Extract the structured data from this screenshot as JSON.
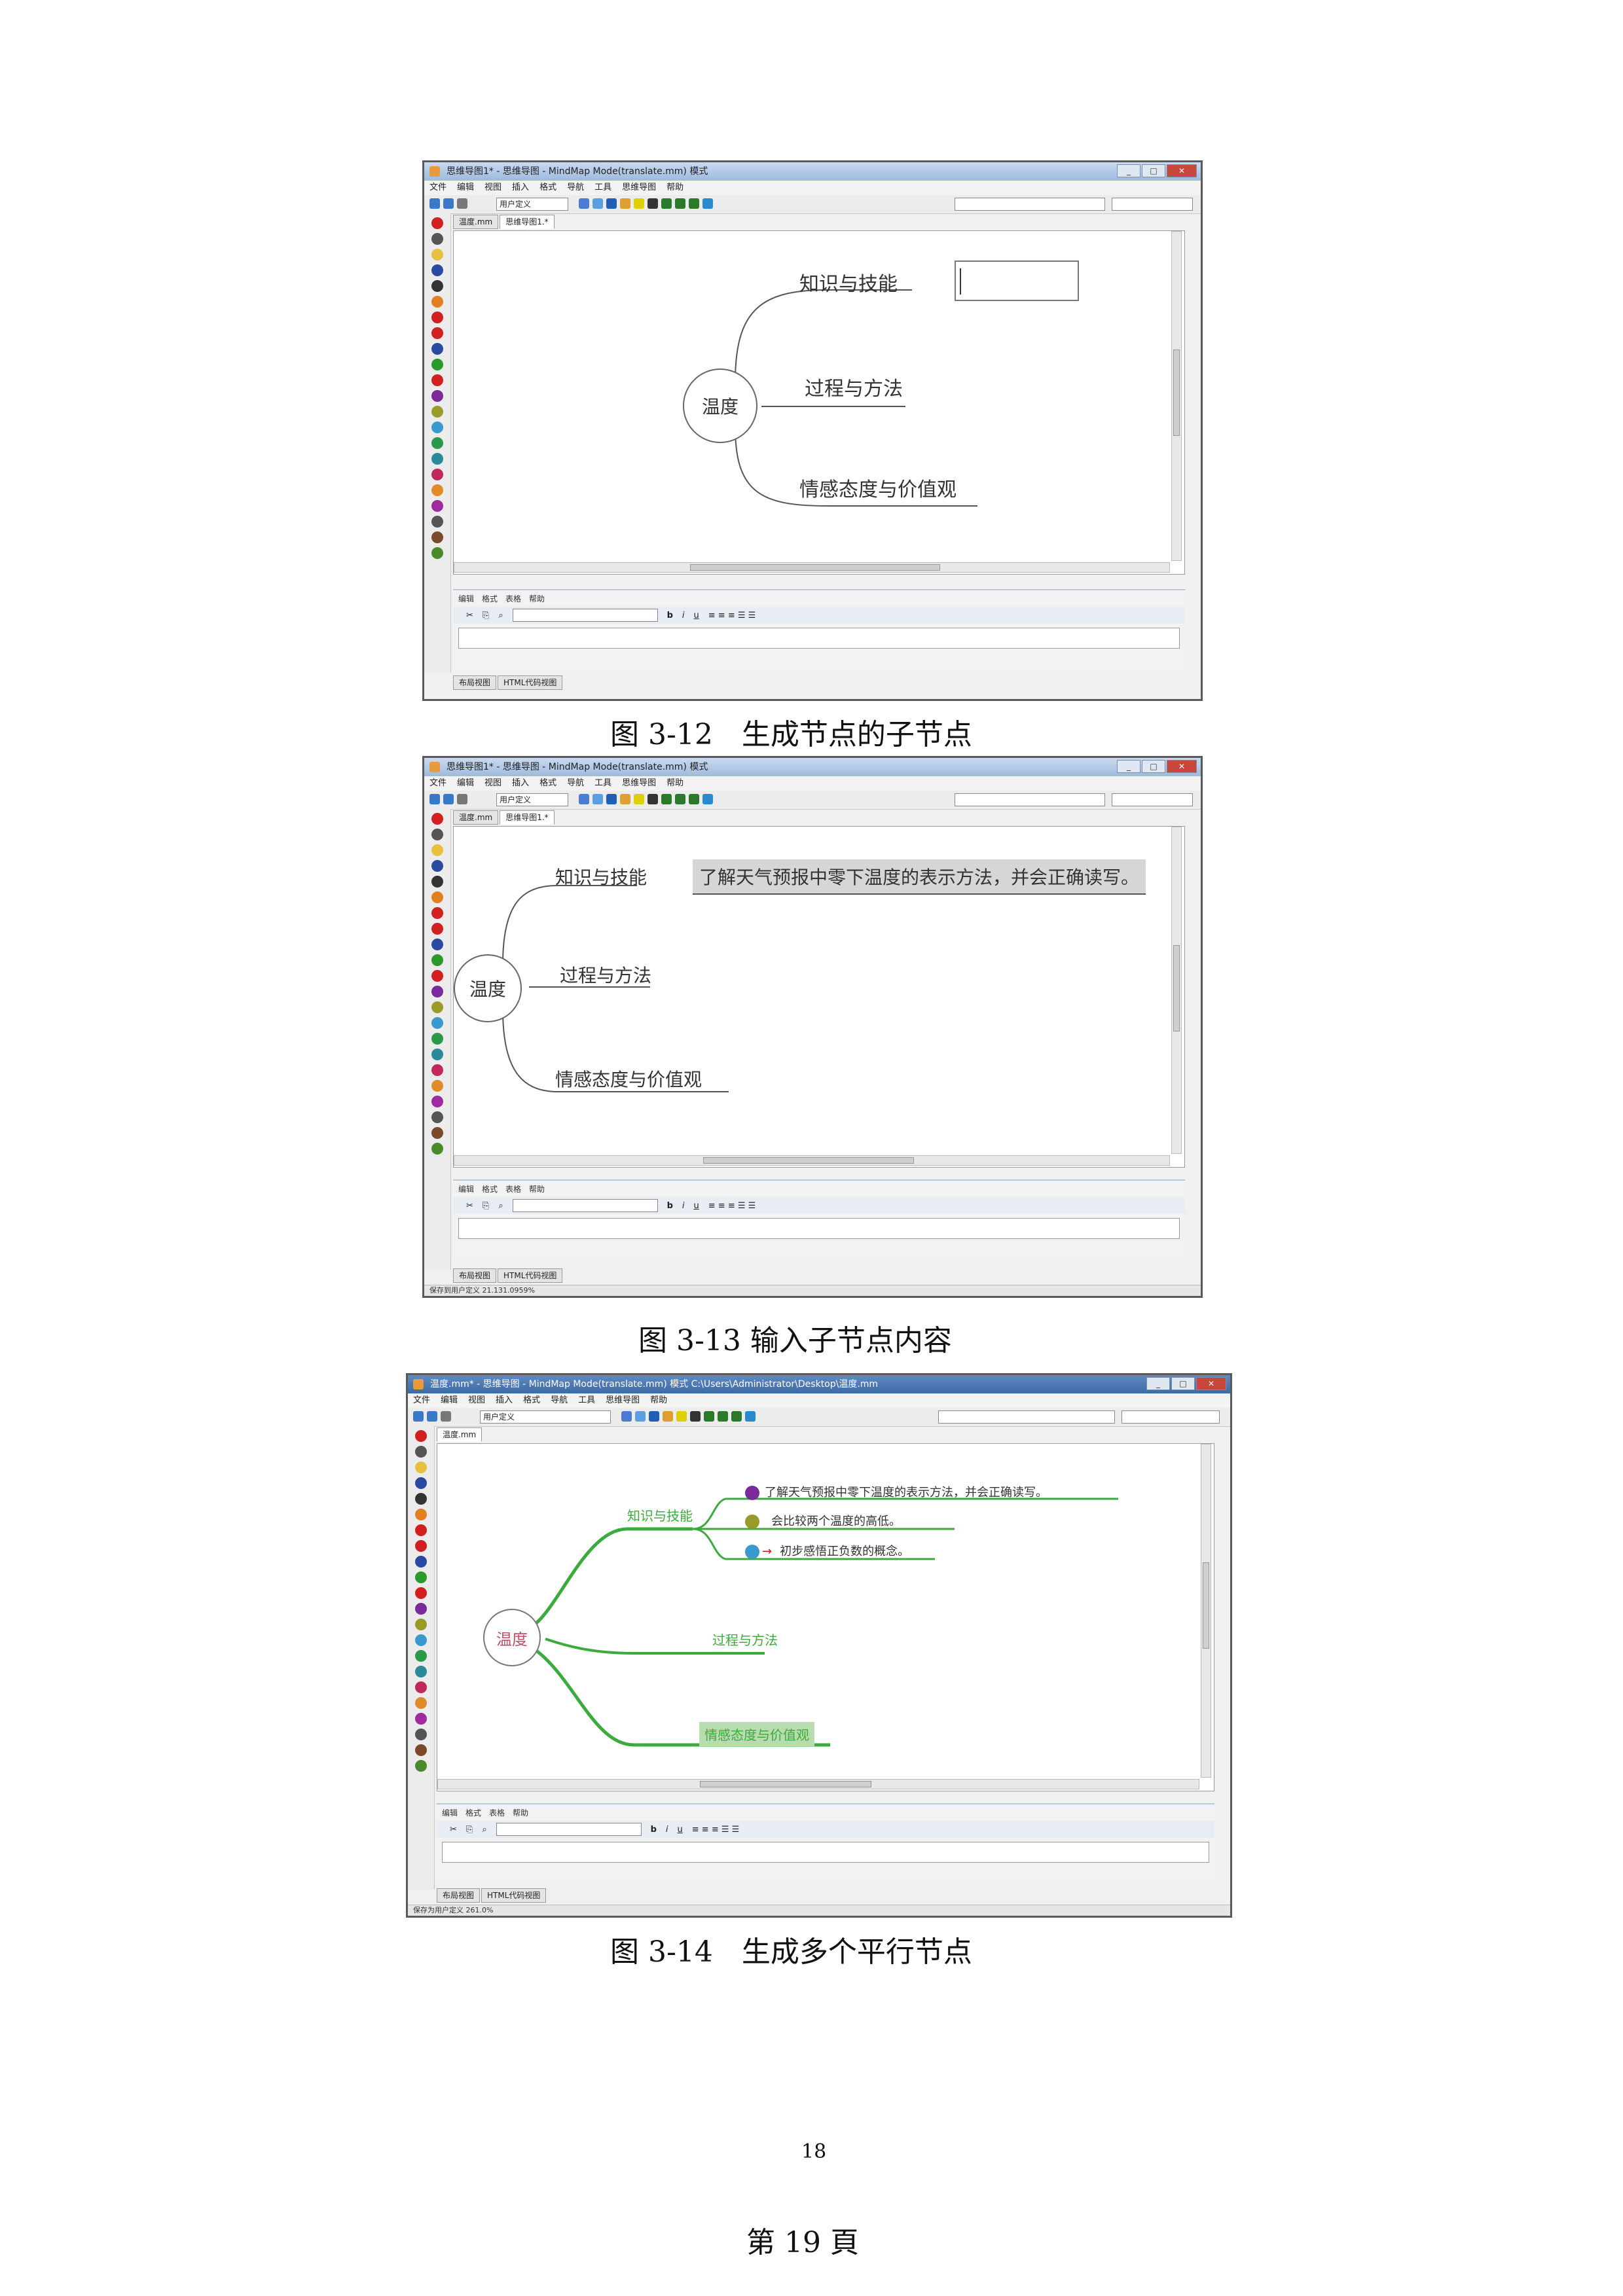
{
  "figures": [
    {
      "window_title": "思维导图1* - 思维导图 - MindMap Mode(translate.mm) 模式",
      "menu": [
        "文件",
        "编辑",
        "视图",
        "插入",
        "格式",
        "导航",
        "工具",
        "思维导图",
        "帮助"
      ],
      "style_value": "用户定义",
      "tabs": [
        "温度.mm",
        "思维导图1.*"
      ],
      "mindmap": {
        "root": "温度",
        "children": [
          "知识与技能",
          "过程与方法",
          "情感态度与价值观"
        ]
      },
      "notes_menu": [
        "编辑",
        "格式",
        "表格",
        "帮助"
      ],
      "bottom_tabs": [
        "布局视图",
        "HTML代码视图"
      ],
      "status": "",
      "caption": "图 3-12　生成节点的子节点"
    },
    {
      "window_title": "思维导图1* - 思维导图 - MindMap Mode(translate.mm) 模式",
      "menu": [
        "文件",
        "编辑",
        "视图",
        "插入",
        "格式",
        "导航",
        "工具",
        "思维导图",
        "帮助"
      ],
      "style_value": "用户定义",
      "tabs": [
        "温度.mm",
        "思维导图1.*"
      ],
      "mindmap": {
        "root": "温度",
        "children": [
          "知识与技能",
          "过程与方法",
          "情感态度与价值观"
        ],
        "edited_child": "了解天气预报中零下温度的表示方法，并会正确读写。"
      },
      "notes_menu": [
        "编辑",
        "格式",
        "表格",
        "帮助"
      ],
      "bottom_tabs": [
        "布局视图",
        "HTML代码视图"
      ],
      "status": "保存到用户定义 21.131.0959%",
      "caption": "图 3-13 输入子节点内容"
    },
    {
      "window_title": "温度.mm* - 思维导图 - MindMap Mode(translate.mm) 模式 C:\\Users\\Administrator\\Desktop\\温度.mm",
      "menu": [
        "文件",
        "编辑",
        "视图",
        "插入",
        "格式",
        "导航",
        "工具",
        "思维导图",
        "帮助"
      ],
      "style_value": "用户定义",
      "tabs": [
        "温度.mm"
      ],
      "mindmap": {
        "root": "温度",
        "children": [
          "知识与技能",
          "过程与方法",
          "情感态度与价值观"
        ],
        "grandchildren": [
          "了解天气预报中零下温度的表示方法，并会正确读写。",
          "会比较两个温度的高低。",
          "初步感悟正负数的概念。"
        ]
      },
      "notes_menu": [
        "编辑",
        "格式",
        "表格",
        "帮助"
      ],
      "bottom_tabs": [
        "布局视图",
        "HTML代码视图"
      ],
      "status": "保存为用户定义 261.0%",
      "caption": "图 3-14　生成多个平行节点"
    }
  ],
  "footer": {
    "page_number": "18",
    "page_label": "第 19 頁"
  },
  "colors": {
    "mindmap_green": "#3daa3d",
    "root_pink": "#c0506a",
    "title_blue": "#9fb9dc"
  },
  "icons": [
    "app-icon",
    "minimize-icon",
    "maximize-icon",
    "close-icon",
    "bold-icon",
    "italic-icon",
    "underline-icon",
    "flag-icon",
    "wrench-icon",
    "arrow-icon"
  ]
}
